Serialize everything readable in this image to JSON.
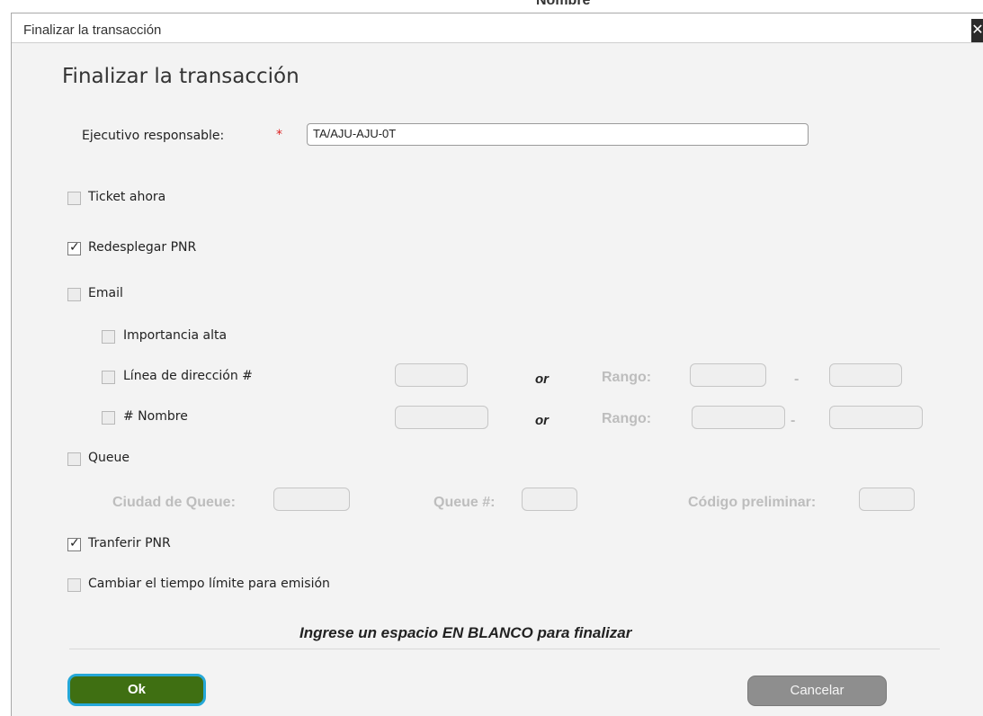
{
  "background": {
    "text": "Nombre"
  },
  "window": {
    "title": "Finalizar la transacción",
    "close_glyph": "✕",
    "heading": "Finalizar la transacción"
  },
  "form": {
    "ejecutivo": {
      "label": "Ejecutivo responsable:",
      "required_mark": "*",
      "value": "TA/AJU-AJU-0T"
    },
    "ticket_ahora": {
      "label": "Ticket ahora",
      "checked": false
    },
    "redesplegar_pnr": {
      "label": "Redesplegar PNR",
      "checked": true
    },
    "email": {
      "label": "Email",
      "checked": false,
      "importancia_alta": {
        "label": "Importancia alta",
        "checked": false
      },
      "linea_direccion": {
        "label": "Línea de dirección #",
        "checked": false,
        "or": "or",
        "rango_label": "Rango:",
        "dash": "-"
      },
      "nombre": {
        "label": "# Nombre",
        "checked": false,
        "or": "or",
        "rango_label": "Rango:",
        "dash": "-"
      }
    },
    "queue": {
      "label": "Queue",
      "checked": false,
      "ciudad_label": "Ciudad de Queue:",
      "queue_num_label": "Queue #:",
      "codigo_label": "Código preliminar:"
    },
    "transferir_pnr": {
      "label": "Tranferir PNR",
      "checked": true
    },
    "cambiar_tiempo": {
      "label": "Cambiar el tiempo límite para emisión",
      "checked": false
    }
  },
  "note": "Ingrese un espacio EN BLANCO para finalizar",
  "buttons": {
    "ok": "Ok",
    "cancel": "Cancelar"
  },
  "colors": {
    "ok_button": "#3f6f12",
    "ok_border": "#25a8d8",
    "cancel_button": "#8e8e8e",
    "required": "#dd2222"
  }
}
